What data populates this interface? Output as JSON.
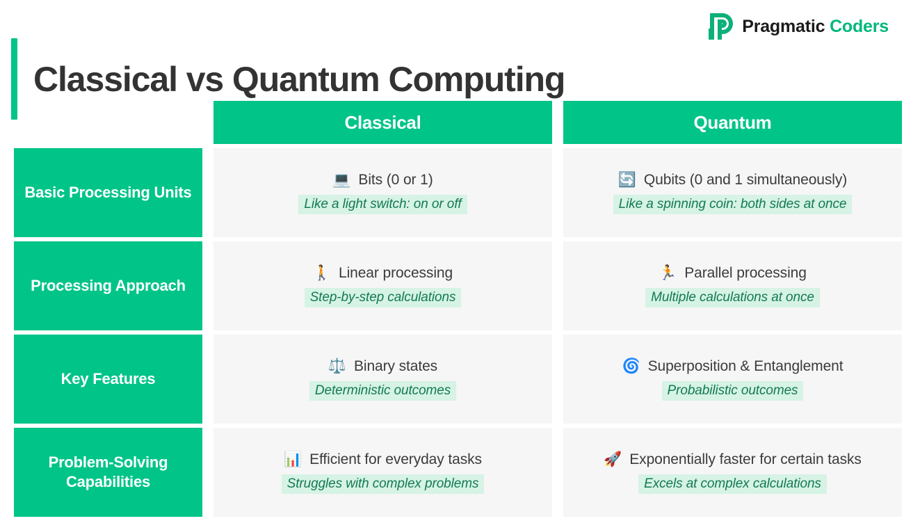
{
  "brand": {
    "logo_icon": "pragmatic-coders-p-mark",
    "name_primary": "Pragmatic",
    "name_accent": "Coders"
  },
  "header": {
    "title": "Classical vs Quantum Computing"
  },
  "colors": {
    "accent_green": "#00c488",
    "brand_green": "#00b87c",
    "title_gray": "#333333",
    "cell_bg": "#f6f6f6",
    "highlight_bg": "#d6f3e5",
    "highlight_text": "#137a52"
  },
  "table": {
    "columns": [
      {
        "label": "Classical"
      },
      {
        "label": "Quantum"
      }
    ],
    "rows": [
      {
        "label": "Basic Processing Units",
        "classical": {
          "icon": "laptop-emoji",
          "emoji": "💻",
          "main": "Bits (0 or 1)",
          "sub": "Like a light switch: on or off"
        },
        "quantum": {
          "icon": "counterclockwise-arrows-emoji",
          "emoji": "🔄",
          "main": "Qubits (0 and 1 simultaneously)",
          "sub": "Like a spinning coin: both sides at once"
        }
      },
      {
        "label": "Processing Approach",
        "classical": {
          "icon": "walking-person-emoji",
          "emoji": "🚶",
          "main": "Linear processing",
          "sub": "Step-by-step calculations"
        },
        "quantum": {
          "icon": "running-person-emoji",
          "emoji": "🏃",
          "main": "Parallel processing",
          "sub": "Multiple calculations at once"
        }
      },
      {
        "label": "Key Features",
        "classical": {
          "icon": "balance-scale-emoji",
          "emoji": "⚖️",
          "main": "Binary states",
          "sub": "Deterministic outcomes"
        },
        "quantum": {
          "icon": "cyclone-emoji",
          "emoji": "🌀",
          "main": "Superposition & Entanglement",
          "sub": "Probabilistic outcomes"
        }
      },
      {
        "label": "Problem-Solving Capabilities",
        "classical": {
          "icon": "bar-chart-emoji",
          "emoji": "📊",
          "main": "Efficient for everyday tasks",
          "sub": "Struggles with complex problems"
        },
        "quantum": {
          "icon": "rocket-emoji",
          "emoji": "🚀",
          "main": "Exponentially faster for certain tasks",
          "sub": "Excels at complex calculations"
        }
      }
    ]
  }
}
